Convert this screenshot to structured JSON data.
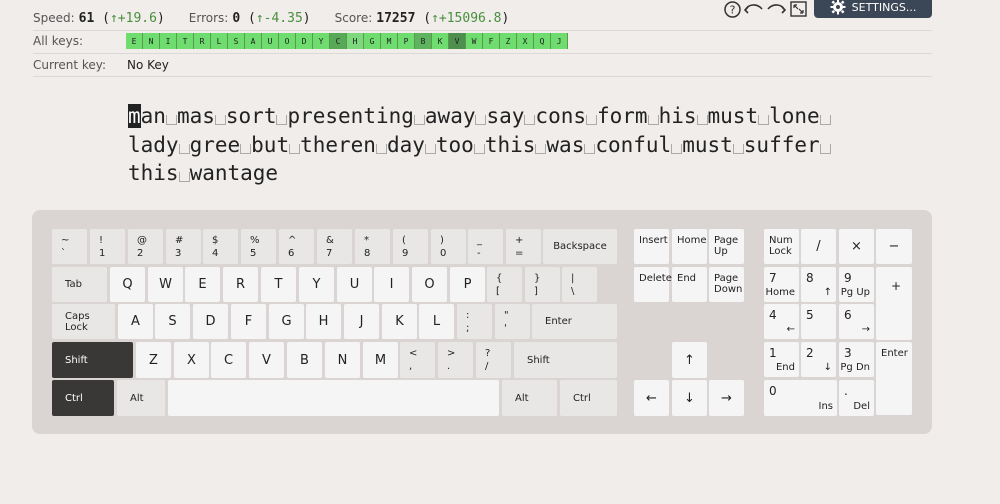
{
  "stats": {
    "speed_label": "Speed:",
    "speed_value": "61",
    "speed_delta": "↑+19.6",
    "errors_label": "Errors:",
    "errors_value": "0",
    "errors_delta": "↑-4.35",
    "score_label": "Score:",
    "score_value": "17257",
    "score_delta": "↑+15096.8"
  },
  "toolbar": {
    "help_icon": "help-icon",
    "undo_icon": "undo-icon",
    "redo_icon": "redo-icon",
    "fullscreen_icon": "fullscreen-icon",
    "settings_label": "SETTINGS..."
  },
  "all_keys": {
    "label": "All keys:",
    "keys": [
      {
        "k": "E",
        "color": "#6fdc6f"
      },
      {
        "k": "N",
        "color": "#6fdc6f"
      },
      {
        "k": "I",
        "color": "#6fdc6f"
      },
      {
        "k": "T",
        "color": "#6fdc6f"
      },
      {
        "k": "R",
        "color": "#6fdc6f"
      },
      {
        "k": "L",
        "color": "#6fdc6f"
      },
      {
        "k": "S",
        "color": "#6fdc6f"
      },
      {
        "k": "A",
        "color": "#6fdc6f"
      },
      {
        "k": "U",
        "color": "#6fdc6f"
      },
      {
        "k": "O",
        "color": "#6fdc6f"
      },
      {
        "k": "D",
        "color": "#6fdc6f"
      },
      {
        "k": "Y",
        "color": "#6fdc6f"
      },
      {
        "k": "C",
        "color": "#57a857"
      },
      {
        "k": "H",
        "color": "#7ed87e"
      },
      {
        "k": "G",
        "color": "#6fdc6f"
      },
      {
        "k": "M",
        "color": "#6fdc6f"
      },
      {
        "k": "P",
        "color": "#6fdc6f"
      },
      {
        "k": "B",
        "color": "#5eb35e"
      },
      {
        "k": "K",
        "color": "#6fdc6f"
      },
      {
        "k": "V",
        "color": "#4e8f4e"
      },
      {
        "k": "W",
        "color": "#6fdc6f"
      },
      {
        "k": "F",
        "color": "#6fdc6f"
      },
      {
        "k": "Z",
        "color": "#6fdc6f"
      },
      {
        "k": "X",
        "color": "#6fdc6f"
      },
      {
        "k": "Q",
        "color": "#6fdc6f"
      },
      {
        "k": "J",
        "color": "#6fdc6f"
      }
    ]
  },
  "current_key": {
    "label": "Current key:",
    "value": "No Key"
  },
  "lesson": {
    "lines": [
      [
        "man",
        "mas",
        "sort",
        "presenting",
        "away",
        "say",
        "cons",
        "form",
        "his",
        "must",
        "lone",
        ""
      ],
      [
        "lady",
        "gree",
        "but",
        "theren",
        "day",
        "too",
        "this",
        "was",
        "conful",
        "must",
        "suffer",
        ""
      ],
      [
        "this",
        "wantage"
      ]
    ]
  },
  "keyboard": {
    "row1": [
      {
        "top": "~",
        "bot": "`"
      },
      {
        "top": "!",
        "bot": "1"
      },
      {
        "top": "@",
        "bot": "2"
      },
      {
        "top": "#",
        "bot": "3"
      },
      {
        "top": "$",
        "bot": "4"
      },
      {
        "top": "%",
        "bot": "5"
      },
      {
        "top": "^",
        "bot": "6"
      },
      {
        "top": "&",
        "bot": "7"
      },
      {
        "top": "*",
        "bot": "8"
      },
      {
        "top": "(",
        "bot": "9"
      },
      {
        "top": ")",
        "bot": "0"
      },
      {
        "top": "_",
        "bot": "-"
      },
      {
        "top": "+",
        "bot": "="
      }
    ],
    "backspace": "Backspace",
    "tab": "Tab",
    "row2": [
      "Q",
      "W",
      "E",
      "R",
      "T",
      "Y",
      "U",
      "I",
      "O",
      "P"
    ],
    "row2_sym": [
      {
        "top": "{",
        "bot": "["
      },
      {
        "top": "}",
        "bot": "]"
      },
      {
        "top": "|",
        "bot": "\\"
      }
    ],
    "caps": "Caps Lock",
    "row3": [
      "A",
      "S",
      "D",
      "F",
      "G",
      "H",
      "J",
      "K",
      "L"
    ],
    "row3_sym": [
      {
        "top": ":",
        "bot": ";"
      },
      {
        "top": "\"",
        "bot": "'"
      }
    ],
    "enter": "Enter",
    "shift_left": "Shift",
    "row4": [
      "Z",
      "X",
      "C",
      "V",
      "B",
      "N",
      "M"
    ],
    "row4_sym": [
      {
        "top": "<",
        "bot": ","
      },
      {
        "top": ">",
        "bot": "."
      },
      {
        "top": "?",
        "bot": "/"
      }
    ],
    "shift_right": "Shift",
    "ctrl_left": "Ctrl",
    "alt_left": "Alt",
    "alt_right": "Alt",
    "ctrl_right": "Ctrl",
    "nav": {
      "insert": "Insert",
      "home": "Home",
      "pageup": "Page Up",
      "delete": "Delete",
      "end": "End",
      "pagedown": "Page Down"
    },
    "arrows": {
      "up": "↑",
      "left": "←",
      "down": "↓",
      "right": "→"
    },
    "numpad": {
      "numlock": "Num Lock",
      "div": "/",
      "mul": "×",
      "minus": "−",
      "n7": "7",
      "n7b": "Home",
      "n8": "8",
      "n8b": "↑",
      "n9": "9",
      "n9b": "Pg Up",
      "plus": "+",
      "n4": "4",
      "n4b": "←",
      "n5": "5",
      "n6": "6",
      "n6b": "→",
      "n1": "1",
      "n1b": "End",
      "n2": "2",
      "n2b": "↓",
      "n3": "3",
      "n3b": "Pg Dn",
      "enter": "Enter",
      "n0": "0",
      "n0b": "Ins",
      "dot": ".",
      "dotb": "Del"
    }
  }
}
